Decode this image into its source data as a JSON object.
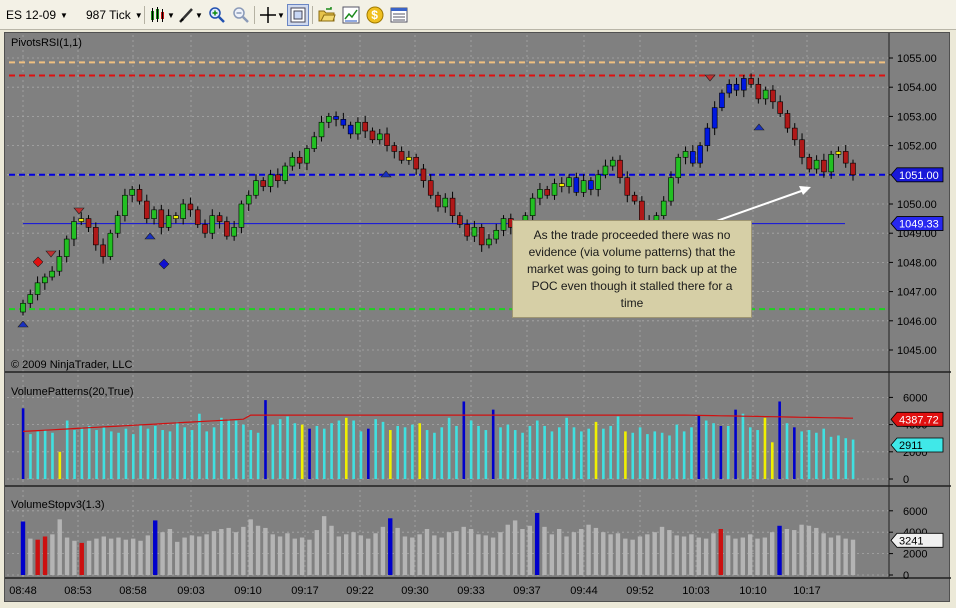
{
  "toolbar": {
    "instrument": "ES 12-09",
    "period": "987 Tick",
    "icons": [
      "bar-chart-style-icon",
      "draw-tool-icon",
      "zoom-in-icon",
      "zoom-out-icon",
      "crosshair-icon",
      "data-box-icon",
      "open-folder-icon",
      "chart-properties-icon",
      "strategies-coin-icon",
      "list-icon"
    ]
  },
  "price_panel": {
    "label": "PivotsRSI(1,1)",
    "copyright": "© 2009 NinjaTrader, LLC",
    "axis_ticks": [
      "1055.00",
      "1054.00",
      "1053.00",
      "1052.00",
      "1051.00",
      "1050.00",
      "1049.00",
      "1048.00",
      "1047.00",
      "1046.00",
      "1045.00"
    ],
    "current_price_badge": "1051.00",
    "poc_badge": "1049.33"
  },
  "volume_panel": {
    "label": "VolumePatterns(20,True)",
    "axis_ticks": [
      "6000",
      "4000",
      "2000",
      "0"
    ],
    "avg_badge": "4387.72",
    "last_badge": "2911"
  },
  "stop_panel": {
    "label": "VolumeStopv3(1.3)",
    "axis_ticks": [
      "6000",
      "4000",
      "2000",
      "0"
    ],
    "last_badge": "3241"
  },
  "x_axis": {
    "labels": [
      "08:48",
      "08:53",
      "08:58",
      "09:03",
      "09:10",
      "09:17",
      "09:22",
      "09:30",
      "09:33",
      "09:37",
      "09:44",
      "09:52",
      "10:03",
      "10:10",
      "10:17"
    ]
  },
  "callout": {
    "text": "As the trade proceeded there was no evidence  (via volume patterns) that the market was going to turn back up at the POC even though it stalled there for a time"
  },
  "colors": {
    "background": "#808080",
    "up_candle": "#22c022",
    "down_candle": "#b01818",
    "doji_candle": "#f0f000",
    "blue_candle": "#0018e0",
    "volume_cyan": "#40e0e0",
    "volume_blue": "#0000cc",
    "volume_yellow": "#f0f000",
    "stop_gray": "#b4b4b4",
    "stop_red": "#cc1010"
  }
}
